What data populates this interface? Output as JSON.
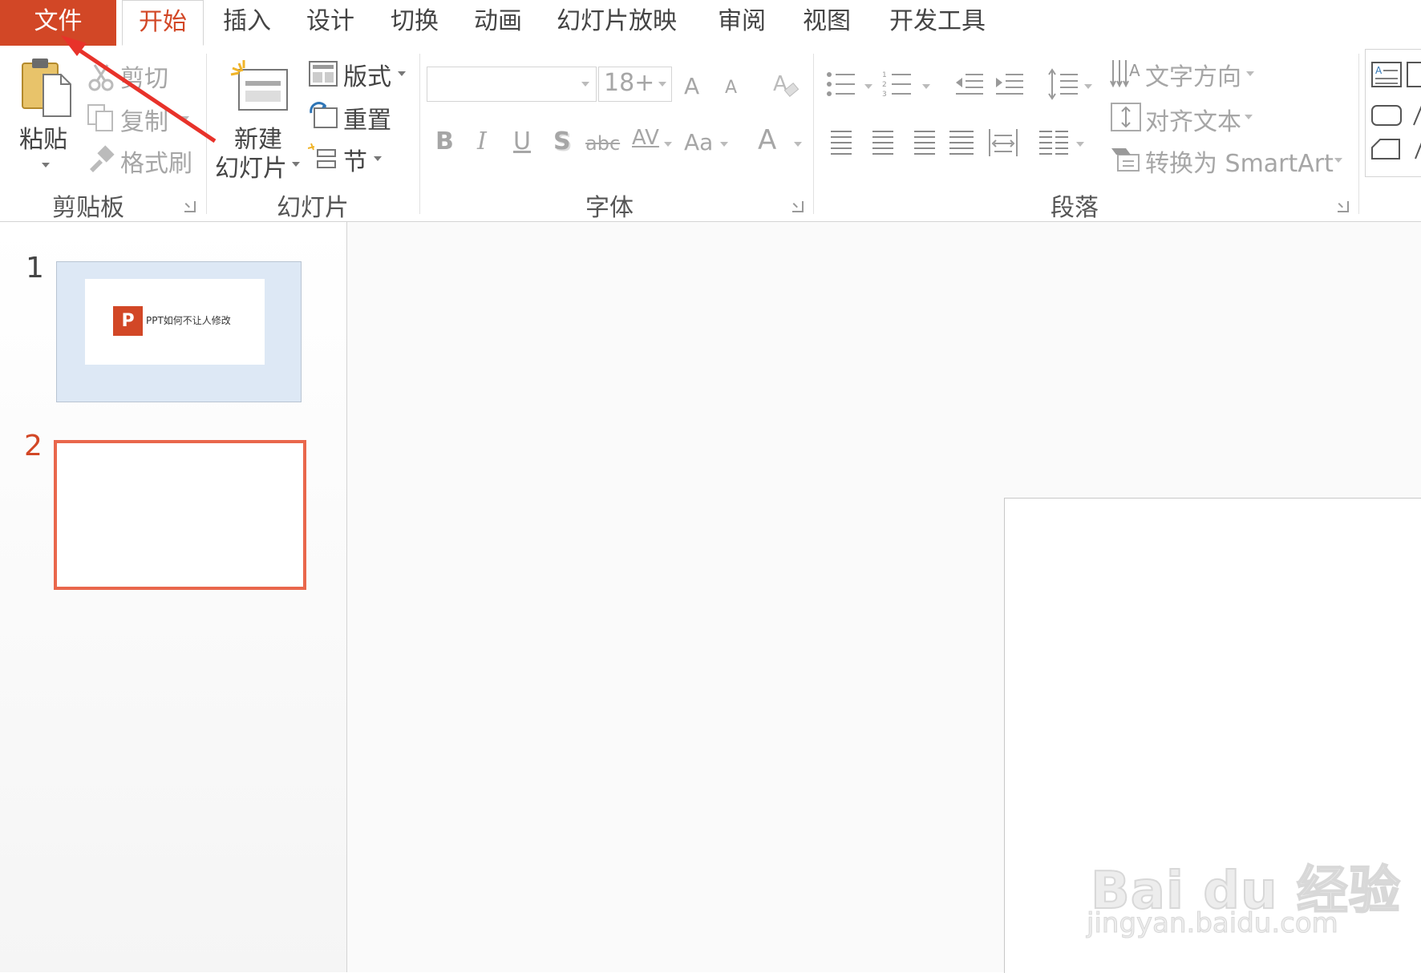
{
  "tabs": [
    "文件",
    "开始",
    "插入",
    "设计",
    "切换",
    "动画",
    "幻灯片放映",
    "审阅",
    "视图",
    "开发工具"
  ],
  "clipboard": {
    "paste": "粘贴",
    "cut": "剪切",
    "copy": "复制",
    "format_painter": "格式刷",
    "group": "剪贴板"
  },
  "slides_group": {
    "new_slide_1": "新建",
    "new_slide_2": "幻灯片",
    "layout": "版式",
    "reset": "重置",
    "section": "节",
    "group": "幻灯片"
  },
  "font": {
    "font_name": "",
    "font_size": "18+",
    "bold": "B",
    "italic": "I",
    "underline": "U",
    "shadow": "S",
    "strikethrough": "abc",
    "spacing": "AV",
    "change_case": "Aa",
    "font_color": "A",
    "grow": "A",
    "shrink": "A",
    "group": "字体"
  },
  "paragraph": {
    "text_direction": "文字方向",
    "align_text": "对齐文本",
    "smartart": "转换为 SmartArt",
    "group": "段落"
  },
  "slide_panel": {
    "slide1_number": "1",
    "slide1_title": "PPT如何不让人修改",
    "slide1_logo": "P",
    "slide2_number": "2"
  },
  "watermark": {
    "brand": "Bai du 经验",
    "url": "jingyan.baidu.com"
  },
  "colors": {
    "accent": "#d24726",
    "selection": "#e9674c"
  }
}
